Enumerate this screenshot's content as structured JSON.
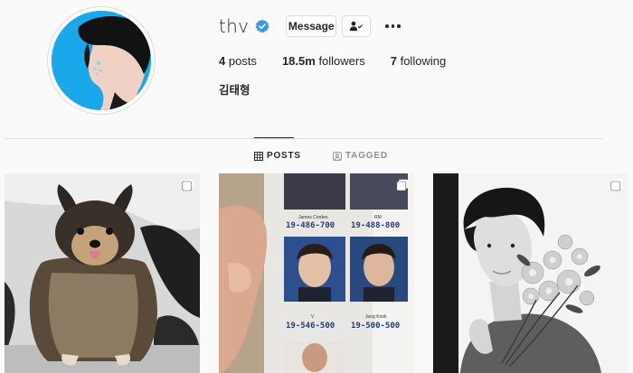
{
  "profile": {
    "username": "thv",
    "verified_icon": "verified-badge-icon",
    "message_label": "Message",
    "follow_icon": "user-check-icon",
    "more_icon": "more-options-icon",
    "posts_count": "4",
    "posts_label": "posts",
    "followers_count": "18.5m",
    "followers_label": "followers",
    "following_count": "7",
    "following_label": "following",
    "full_name": "김태형",
    "accent_color": "#0095f6"
  },
  "tabs": [
    {
      "label": "POSTS",
      "icon": "grid-icon",
      "active": true
    },
    {
      "label": "TAGGED",
      "icon": "tag-icon",
      "active": false
    }
  ],
  "posts": [
    {
      "subject": "pomeranian-dog",
      "multi": true
    },
    {
      "subject": "photo-sticker-sheet",
      "multi": true,
      "texts": {
        "name1": "James Corden",
        "name2": "RM",
        "num1": "19-486-700",
        "num2": "19-488-800",
        "name3": "V",
        "name4": "Jung Kook",
        "num3": "19-546-500",
        "num4": "19-500-500"
      }
    },
    {
      "subject": "portrait-with-flowers",
      "multi": true
    }
  ]
}
